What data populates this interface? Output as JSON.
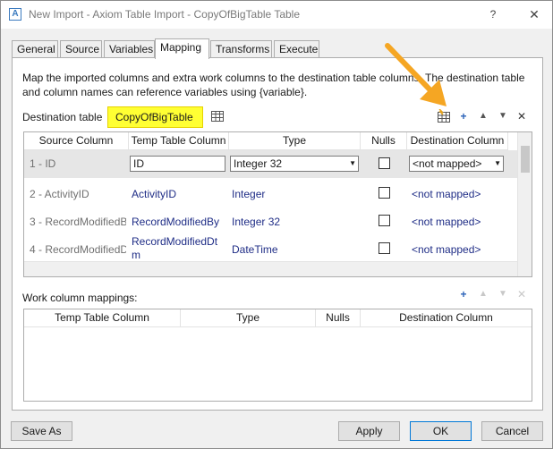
{
  "window": {
    "title": "New Import - Axiom Table Import - CopyOfBigTable Table",
    "app_icon_letter": "A",
    "help_label": "?",
    "close_label": "✕"
  },
  "tabs": [
    {
      "label": "General"
    },
    {
      "label": "Source"
    },
    {
      "label": "Variables"
    },
    {
      "label": "Mapping",
      "active": true
    },
    {
      "label": "Transforms"
    },
    {
      "label": "Execute"
    }
  ],
  "mapping": {
    "description": "Map the imported columns and extra work columns to the destination table columns. The destination table and column names can reference variables using {variable}.",
    "destination_label": "Destination table",
    "destination_value": "CopyOfBigTable",
    "highlight_color": "#ffff33",
    "toolbar": {
      "add_label": "+",
      "up_label": "▲",
      "down_label": "▼",
      "delete_label": "✕"
    },
    "columns": [
      "Source Column",
      "Temp Table Column",
      "Type",
      "Nulls",
      "Destination Column"
    ],
    "rows": [
      {
        "source": "1 - ID",
        "temp": "ID",
        "type": "Integer 32",
        "nulls": false,
        "dest": "<not mapped>",
        "selected": true
      },
      {
        "source": "2 - ActivityID",
        "temp": "ActivityID",
        "type": "Integer",
        "nulls": false,
        "dest": "<not mapped>"
      },
      {
        "source": "3 - RecordModifiedB",
        "temp": "RecordModifiedBy",
        "type": "Integer 32",
        "nulls": false,
        "dest": "<not mapped>"
      },
      {
        "source": "4 - RecordModifiedD",
        "temp_line1": "RecordModifiedDt",
        "temp_line2": "m",
        "type": "DateTime",
        "nulls": false,
        "dest": "<not mapped>"
      }
    ]
  },
  "work": {
    "label": "Work column mappings:",
    "columns": [
      "Temp Table Column",
      "Type",
      "Nulls",
      "Destination Column"
    ],
    "toolbar": {
      "add_label": "+",
      "up_label": "▲",
      "down_label": "▼",
      "delete_label": "✕"
    }
  },
  "buttons": {
    "save_as": "Save As",
    "apply": "Apply",
    "ok": "OK",
    "cancel": "Cancel"
  },
  "annotation_arrow_color": "#f5a623"
}
